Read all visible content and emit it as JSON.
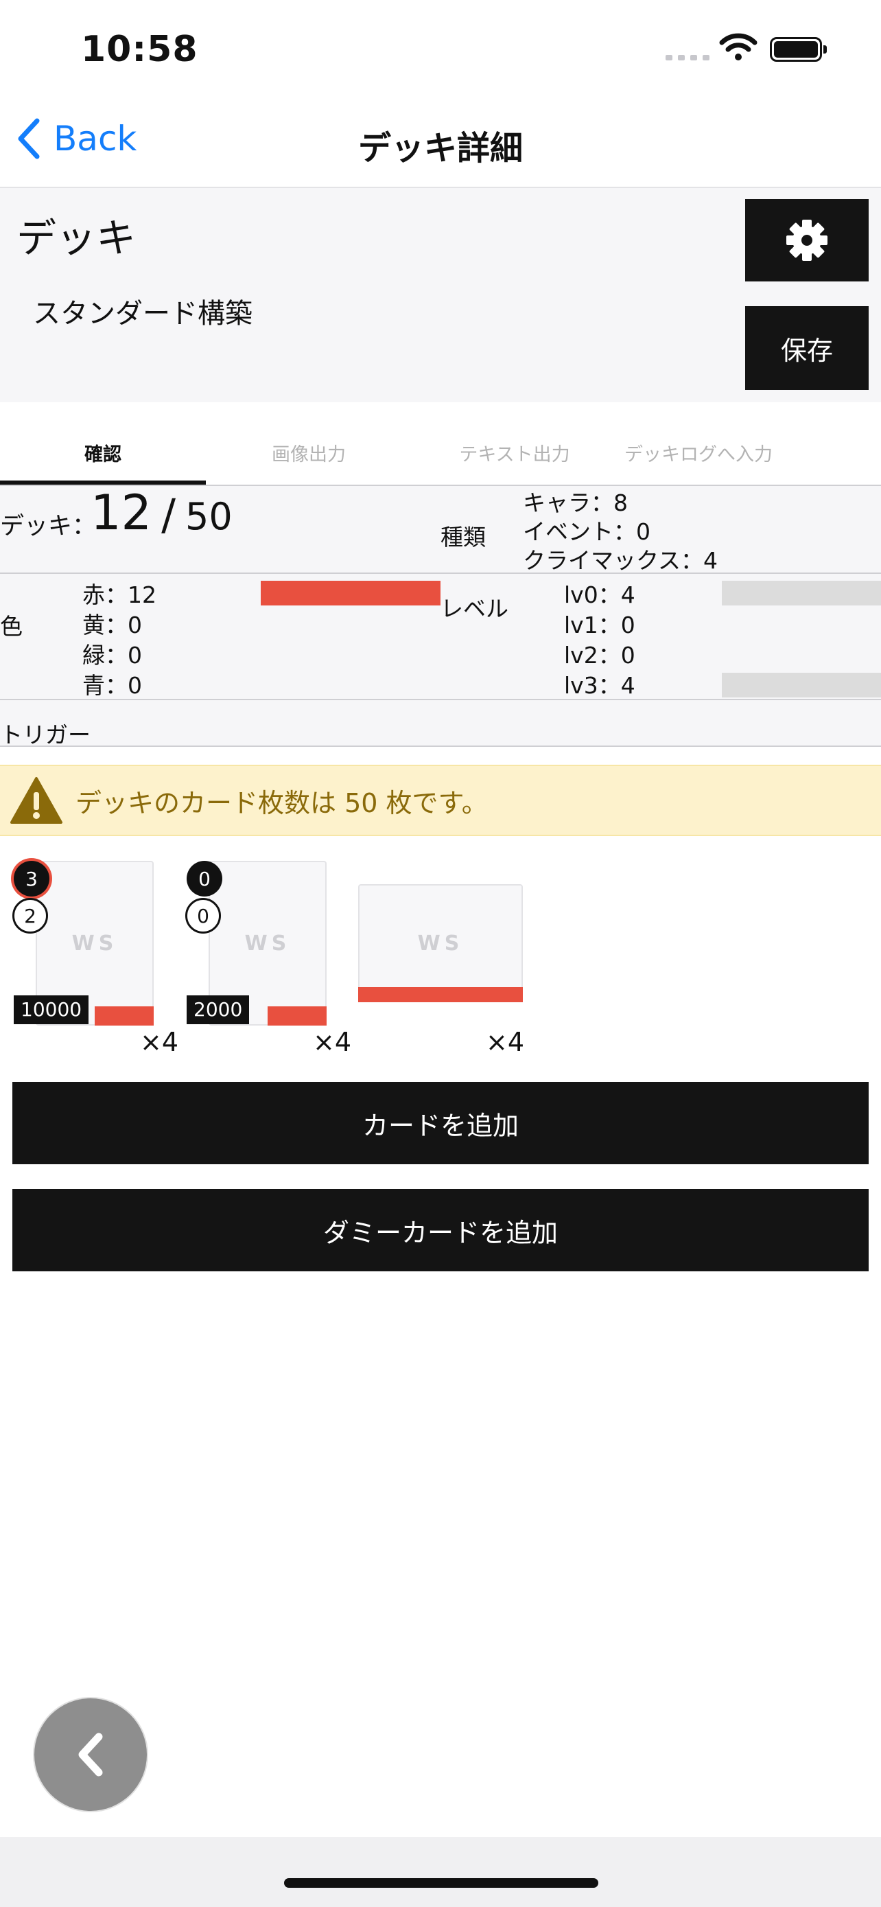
{
  "status": {
    "time": "10:58"
  },
  "nav": {
    "back_label": "Back",
    "title": "デッキ詳細"
  },
  "deck": {
    "name": "デッキ",
    "format": "スタンダード構築",
    "save_label": "保存"
  },
  "tabs": [
    {
      "label": "確認",
      "active": true
    },
    {
      "label": "画像出力",
      "active": false
    },
    {
      "label": "テキスト出力",
      "active": false
    },
    {
      "label": "デッキログへ入力",
      "active": false
    }
  ],
  "stats": {
    "deck_label": "デッキ：",
    "deck_count": "12",
    "deck_slash": "/",
    "deck_max": "50",
    "type_label": "種類",
    "types": [
      "キャラ：8",
      "イベント：0",
      "クライマックス：4"
    ],
    "color_label": "色",
    "colors": [
      {
        "text": "赤：12",
        "value": 12
      },
      {
        "text": "黄：0",
        "value": 0
      },
      {
        "text": "緑：0",
        "value": 0
      },
      {
        "text": "青：0",
        "value": 0
      }
    ],
    "level_label": "レベル",
    "levels": [
      {
        "text": "lv0：4",
        "value": 4
      },
      {
        "text": "lv1：0",
        "value": 0
      },
      {
        "text": "lv2：0",
        "value": 0
      },
      {
        "text": "lv3：4",
        "value": 4
      }
    ],
    "trigger_label": "トリガー"
  },
  "warning": {
    "text": "デッキのカード枚数は 50 枚です。",
    "icon": "warning-icon"
  },
  "cards": [
    {
      "placeholder": "WS",
      "badge_top": "3",
      "badge_bottom": "2",
      "power": "10000",
      "qty": "×4"
    },
    {
      "placeholder": "WS",
      "badge_top": "0",
      "badge_bottom": "0",
      "power": "2000",
      "qty": "×4"
    },
    {
      "placeholder": "WS",
      "qty": "×4"
    }
  ],
  "buttons": {
    "add_card": "カードを追加",
    "add_dummy": "ダミーカードを追加"
  },
  "colors": {
    "accent_red": "#e8503f",
    "link_blue": "#147efb",
    "dark": "#141414",
    "warning_bg": "#fdf2cc",
    "warning_text": "#8a6a0a"
  }
}
